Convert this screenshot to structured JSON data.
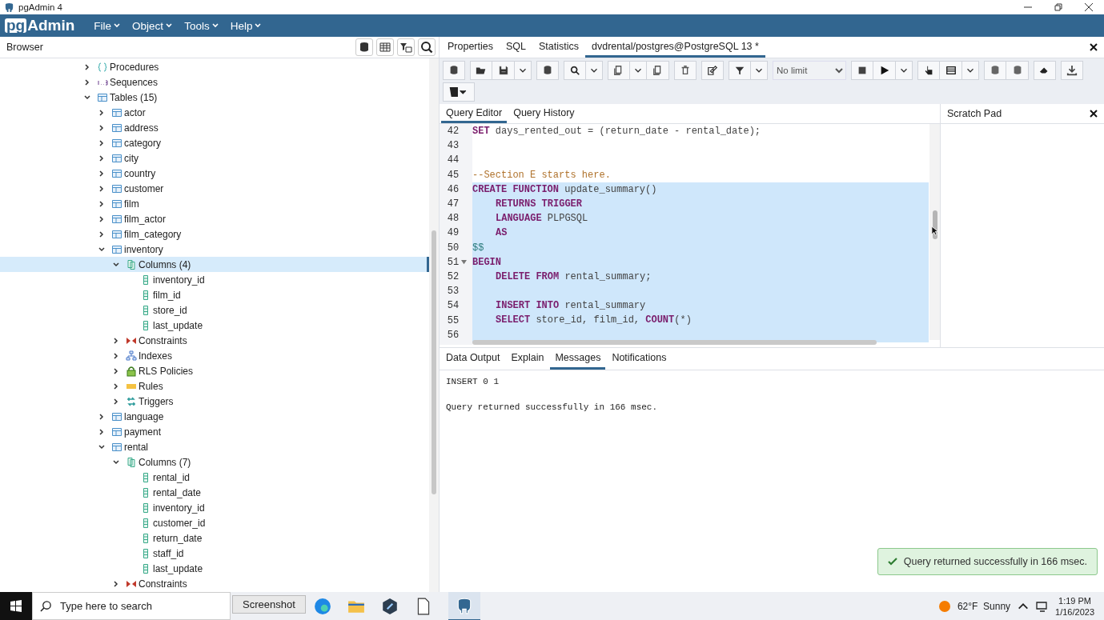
{
  "window": {
    "title": "pgAdmin 4"
  },
  "logo": {
    "prefix": "pg",
    "name": "Admin"
  },
  "menu": [
    {
      "label": "File"
    },
    {
      "label": "Object"
    },
    {
      "label": "Tools"
    },
    {
      "label": "Help"
    }
  ],
  "browser": {
    "title": "Browser"
  },
  "tree": [
    {
      "label": "Procedures",
      "kind": "procedures",
      "expanded": false,
      "selected": false
    },
    {
      "label": "Sequences",
      "kind": "sequences",
      "expanded": false,
      "selected": false
    },
    {
      "label": "Tables (15)",
      "kind": "tables",
      "expanded": true,
      "selected": false,
      "children": [
        {
          "label": "actor",
          "kind": "table",
          "expanded": false,
          "selected": false
        },
        {
          "label": "address",
          "kind": "table",
          "expanded": false,
          "selected": false
        },
        {
          "label": "category",
          "kind": "table",
          "expanded": false,
          "selected": false
        },
        {
          "label": "city",
          "kind": "table",
          "expanded": false,
          "selected": false
        },
        {
          "label": "country",
          "kind": "table",
          "expanded": false,
          "selected": false
        },
        {
          "label": "customer",
          "kind": "table",
          "expanded": false,
          "selected": false
        },
        {
          "label": "film",
          "kind": "table",
          "expanded": false,
          "selected": false
        },
        {
          "label": "film_actor",
          "kind": "table",
          "expanded": false,
          "selected": false
        },
        {
          "label": "film_category",
          "kind": "table",
          "expanded": false,
          "selected": false
        },
        {
          "label": "inventory",
          "kind": "table",
          "expanded": true,
          "selected": false,
          "children": [
            {
              "label": "Columns (4)",
              "kind": "columns",
              "expanded": true,
              "selected": true,
              "children": [
                {
                  "label": "inventory_id",
                  "kind": "column",
                  "selected": false
                },
                {
                  "label": "film_id",
                  "kind": "column",
                  "selected": false
                },
                {
                  "label": "store_id",
                  "kind": "column",
                  "selected": false
                },
                {
                  "label": "last_update",
                  "kind": "column",
                  "selected": false
                }
              ]
            },
            {
              "label": "Constraints",
              "kind": "constraints",
              "expanded": false,
              "selected": false
            },
            {
              "label": "Indexes",
              "kind": "indexes",
              "expanded": false,
              "selected": false
            },
            {
              "label": "RLS Policies",
              "kind": "rls",
              "expanded": false,
              "selected": false
            },
            {
              "label": "Rules",
              "kind": "rules",
              "expanded": false,
              "selected": false
            },
            {
              "label": "Triggers",
              "kind": "triggers",
              "expanded": false,
              "selected": false
            }
          ]
        },
        {
          "label": "language",
          "kind": "table",
          "expanded": false,
          "selected": false
        },
        {
          "label": "payment",
          "kind": "table",
          "expanded": false,
          "selected": false
        },
        {
          "label": "rental",
          "kind": "table",
          "expanded": true,
          "selected": false,
          "children": [
            {
              "label": "Columns (7)",
              "kind": "columns",
              "expanded": true,
              "selected": false,
              "children": [
                {
                  "label": "rental_id",
                  "kind": "column",
                  "selected": false
                },
                {
                  "label": "rental_date",
                  "kind": "column",
                  "selected": false
                },
                {
                  "label": "inventory_id",
                  "kind": "column",
                  "selected": false
                },
                {
                  "label": "customer_id",
                  "kind": "column",
                  "selected": false
                },
                {
                  "label": "return_date",
                  "kind": "column",
                  "selected": false
                },
                {
                  "label": "staff_id",
                  "kind": "column",
                  "selected": false
                },
                {
                  "label": "last_update",
                  "kind": "column",
                  "selected": false
                }
              ]
            },
            {
              "label": "Constraints",
              "kind": "constraints",
              "expanded": false,
              "selected": false
            }
          ]
        }
      ]
    }
  ],
  "tabs": [
    {
      "label": "Properties",
      "selected": false
    },
    {
      "label": "SQL",
      "selected": false
    },
    {
      "label": "Statistics",
      "selected": false
    },
    {
      "label": "dvdrental/postgres@PostgreSQL 13 *",
      "selected": true
    }
  ],
  "toolbar": {
    "limit": "No limit"
  },
  "editor_tabs": [
    {
      "label": "Query Editor",
      "selected": true
    },
    {
      "label": "Query History",
      "selected": false
    }
  ],
  "scratch_pad": {
    "title": "Scratch Pad"
  },
  "code": [
    {
      "n": "42",
      "selected": false,
      "indented": false,
      "tokens": [
        {
          "text": "SET",
          "kind": "keyword"
        },
        {
          "text": "days_rented_out = (return_date - rental_date);",
          "kind": "identifier"
        }
      ]
    },
    {
      "n": "43",
      "selected": false
    },
    {
      "n": "44",
      "selected": false
    },
    {
      "n": "45",
      "selected": false,
      "indented": false,
      "tokens": [
        {
          "text": "--Section E starts here.",
          "kind": "comment"
        }
      ]
    },
    {
      "n": "46",
      "selected": true,
      "indented": false,
      "tokens": [
        {
          "text": "CREATE FUNCTION",
          "kind": "keyword"
        },
        {
          "text": "update_summary()",
          "kind": "identifier"
        }
      ]
    },
    {
      "n": "47",
      "selected": true,
      "indented": true,
      "tokens": [
        {
          "text": "RETURNS TRIGGER",
          "kind": "keyword"
        }
      ]
    },
    {
      "n": "48",
      "selected": true,
      "indented": true,
      "tokens": [
        {
          "text": "LANGUAGE",
          "kind": "keyword"
        },
        {
          "text": "PLPGSQL",
          "kind": "identifier"
        }
      ]
    },
    {
      "n": "49",
      "selected": true,
      "indented": true,
      "tokens": [
        {
          "text": "AS",
          "kind": "keyword"
        }
      ]
    },
    {
      "n": "50",
      "selected": true,
      "indented": false,
      "tokens": [
        {
          "text": "$$",
          "kind": "dollar"
        }
      ]
    },
    {
      "n": "51",
      "selected": true,
      "indented": false,
      "fold": true,
      "tokens": [
        {
          "text": "BEGIN",
          "kind": "keyword"
        }
      ]
    },
    {
      "n": "52",
      "selected": true,
      "indented": true,
      "tokens": [
        {
          "text": "DELETE FROM",
          "kind": "keyword"
        },
        {
          "text": "rental_summary;",
          "kind": "identifier"
        }
      ]
    },
    {
      "n": "53",
      "selected": true
    },
    {
      "n": "54",
      "selected": true,
      "indented": true,
      "tokens": [
        {
          "text": "INSERT INTO",
          "kind": "keyword"
        },
        {
          "text": "rental_summary",
          "kind": "identifier"
        }
      ]
    },
    {
      "n": "55",
      "selected": true,
      "indented": true,
      "tokens": [
        {
          "text": "SELECT",
          "kind": "keyword"
        },
        {
          "text": "store_id, film_id,",
          "kind": "identifier"
        },
        {
          "text": "COUNT",
          "kind": "keyword"
        },
        {
          "text": "(*)",
          "kind": "punct"
        }
      ]
    },
    {
      "n": "56",
      "selected": true
    }
  ],
  "result_tabs": [
    {
      "label": "Data Output",
      "selected": false
    },
    {
      "label": "Explain",
      "selected": false
    },
    {
      "label": "Messages",
      "selected": true
    },
    {
      "label": "Notifications",
      "selected": false
    }
  ],
  "messages": [
    "INSERT 0 1",
    "Query returned successfully in 166 msec."
  ],
  "toast": {
    "text": "Query returned successfully in 166 msec."
  },
  "taskbar": {
    "search_placeholder": "Type here to search",
    "tooltip": "Screenshot",
    "weather": "62°F  Sunny",
    "time": "1:19 PM",
    "date": "1/16/2023"
  }
}
